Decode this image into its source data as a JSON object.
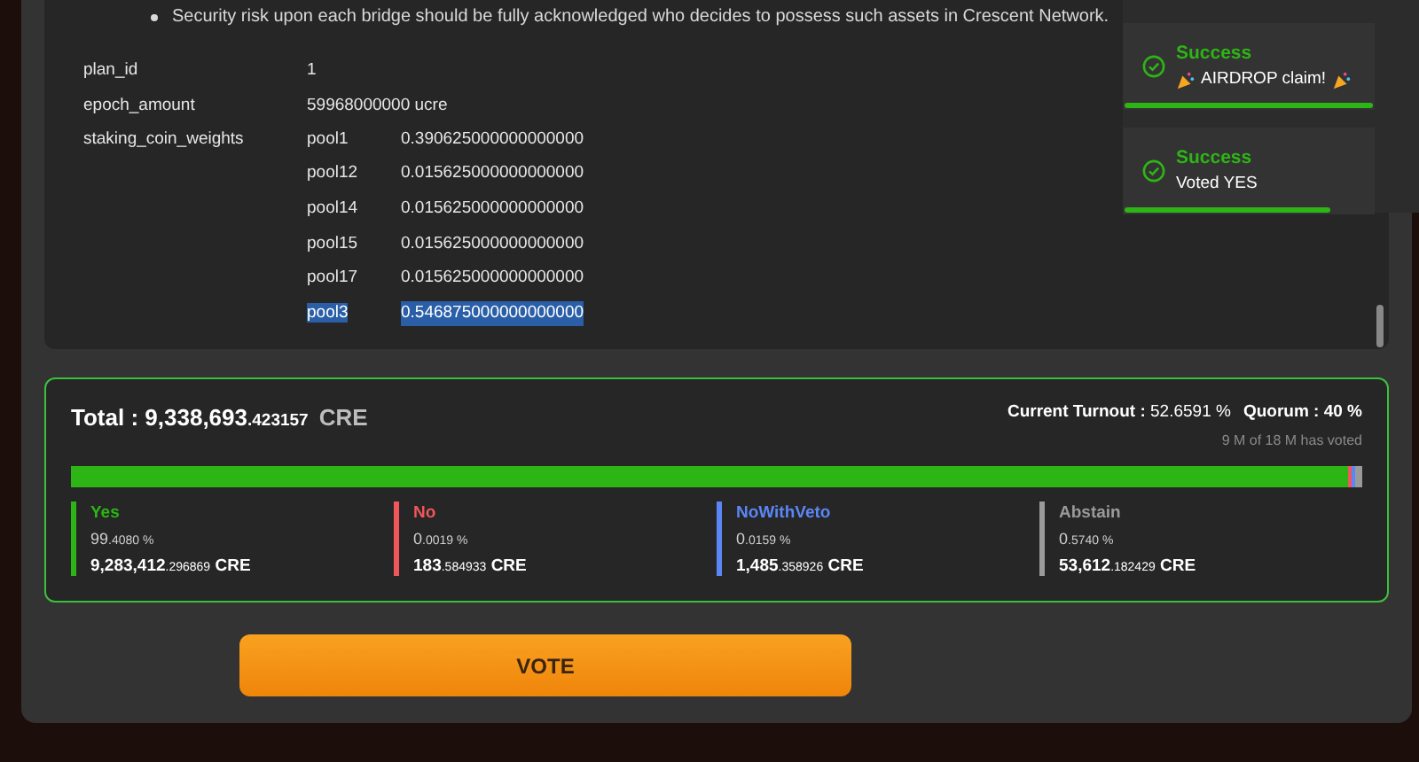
{
  "description": {
    "bullet": "Security risk upon each bridge should be fully acknowledged who decides to possess such assets in Crescent Network.",
    "fields": [
      {
        "label": "plan_id",
        "value": "1"
      },
      {
        "label": "epoch_amount",
        "value": "59968000000 ucre"
      },
      {
        "label": "staking_coin_weights",
        "weights": [
          {
            "pool": "pool1",
            "weight": "0.390625000000000000",
            "selected": false
          },
          {
            "pool": "pool12",
            "weight": "0.015625000000000000",
            "selected": false
          },
          {
            "pool": "pool14",
            "weight": "0.015625000000000000",
            "selected": false
          },
          {
            "pool": "pool15",
            "weight": "0.015625000000000000",
            "selected": false
          },
          {
            "pool": "pool17",
            "weight": "0.015625000000000000",
            "selected": false
          },
          {
            "pool": "pool3",
            "weight": "0.546875000000000000",
            "selected": true
          }
        ]
      }
    ]
  },
  "toasts": [
    {
      "title": "Success",
      "message": "AIRDROP claim!",
      "party": true,
      "level": 1.0
    },
    {
      "title": "Success",
      "message": "Voted YES",
      "party": false,
      "level": 0.83
    }
  ],
  "tally": {
    "total_label": "Total :",
    "total_whole": "9,338,693",
    "total_fraction": ".423157",
    "total_unit": "CRE",
    "turnout_label": "Current Turnout :",
    "turnout_value": "52.6591 %",
    "quorum_label": "Quorum :",
    "quorum_value": "40 %",
    "voted": "9 M of 18 M has voted",
    "options": [
      {
        "name": "Yes",
        "color": "#2db515",
        "level": 0.99408,
        "percent_whole": "99",
        "percent_fraction": ".4080 %",
        "amount_whole": "9,283,412",
        "amount_fraction": ".296869",
        "unit": "CRE"
      },
      {
        "name": "No",
        "color": "#f0565a",
        "level": 1.9e-05,
        "percent_whole": "0",
        "percent_fraction": ".0019 %",
        "amount_whole": "183",
        "amount_fraction": ".584933",
        "unit": "CRE"
      },
      {
        "name": "NoWithVeto",
        "color": "#5b86f5",
        "level": 0.000159,
        "percent_whole": "0",
        "percent_fraction": ".0159 %",
        "amount_whole": "1,485",
        "amount_fraction": ".358926",
        "unit": "CRE"
      },
      {
        "name": "Abstain",
        "color": "#9a9a9a",
        "level": 0.00574,
        "percent_whole": "0",
        "percent_fraction": ".5740 %",
        "amount_whole": "53,612",
        "amount_fraction": ".182429",
        "unit": "CRE"
      }
    ]
  },
  "vote_button": "VOTE"
}
